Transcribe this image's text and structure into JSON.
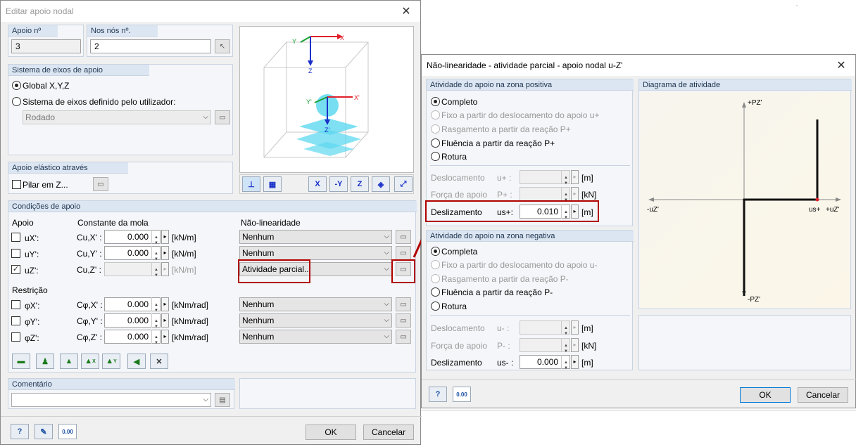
{
  "background": {
    "top_right_char": "·"
  },
  "dlg1": {
    "title": "Editar apoio nodal",
    "close_icon": "close-icon",
    "apoio_no": {
      "label": "Apoio nº",
      "value": "3"
    },
    "nos_no": {
      "label": "Nos nós nº.",
      "value": "2"
    },
    "sistema": {
      "header": "Sistema de eixos de apoio",
      "global": "Global X,Y,Z",
      "user": "Sistema de eixos definido pelo utilizador:",
      "combo": "Rodado"
    },
    "elastic": {
      "header": "Apoio elástico através",
      "pilar": "Pilar em Z..."
    },
    "preview_axes": {
      "x": "X",
      "y": "Y",
      "z": "Z",
      "xp": "X'",
      "yp": "Y'",
      "zp": "Z'"
    },
    "cond": {
      "header": "Condições de apoio",
      "col_apoio": "Apoio",
      "col_mola": "Constante da mola",
      "col_nl": "Não-linearidade",
      "restricao": "Restrição",
      "rows": [
        {
          "name": "uX':",
          "cname": "Cu,X' :",
          "value": "0.000",
          "unit": "[kN/m]",
          "nl": "Nenhum",
          "checked": ""
        },
        {
          "name": "uY':",
          "cname": "Cu,Y' :",
          "value": "0.000",
          "unit": "[kN/m]",
          "nl": "Nenhum",
          "checked": ""
        },
        {
          "name": "uZ':",
          "cname": "Cu,Z' :",
          "value": "",
          "unit": "[kN/m]",
          "nl": "Atividade parcial...",
          "checked": "✓"
        },
        {
          "name": "φX':",
          "cname": "Cφ,X' :",
          "value": "0.000",
          "unit": "[kNm/rad]",
          "nl": "Nenhum",
          "checked": ""
        },
        {
          "name": "φY':",
          "cname": "Cφ,Y' :",
          "value": "0.000",
          "unit": "[kNm/rad]",
          "nl": "Nenhum",
          "checked": ""
        },
        {
          "name": "φZ':",
          "cname": "Cφ,Z' :",
          "value": "0.000",
          "unit": "[kNm/rad]",
          "nl": "Nenhum",
          "checked": ""
        }
      ],
      "toolbar_marks": [
        "X",
        "Y"
      ]
    },
    "comment": {
      "header": "Comentário",
      "value": ""
    },
    "ok": "OK",
    "cancel": "Cancelar",
    "units_icon_text": "0.00"
  },
  "dlg2": {
    "title": "Não-linearidade - atividade parcial - apoio nodal u-Z'",
    "close_icon": "close-icon",
    "pos": {
      "header": "Atividade do apoio na zona positiva",
      "options": [
        "Completo",
        "Fixo a partir do deslocamento do apoio u+",
        "Rasgamento a partir da reação P+",
        "Fluência a partir da reação P+",
        "Rotura"
      ],
      "desl_label": "Deslocamento",
      "desl_sym": "u+ :",
      "desl_unit": "[m]",
      "forca_label": "Força de apoio",
      "forca_sym": "P+ :",
      "forca_unit": "[kN]",
      "desliz_label": "Deslizamento",
      "desliz_sym": "us+:",
      "desliz_value": "0.010",
      "desliz_unit": "[m]"
    },
    "neg": {
      "header": "Atividade do apoio na zona negativa",
      "options": [
        "Completa",
        "Fixo a partir do deslocamento do apoio u-",
        "Rasgamento a partir da reação P-",
        "Fluência a partir da reação P-",
        "Rotura"
      ],
      "desl_label": "Deslocamento",
      "desl_sym": "u- :",
      "desl_unit": "[m]",
      "forca_label": "Força de apoio",
      "forca_sym": "P- :",
      "forca_unit": "[kN]",
      "desliz_label": "Deslizamento",
      "desliz_sym": "us- :",
      "desliz_value": "0.000",
      "desliz_unit": "[m]"
    },
    "diagram": {
      "header": "Diagrama de atividade",
      "pz_pos": "+PZ'",
      "pz_neg": "-PZ'",
      "uz_neg": "-uZ'",
      "uz_pos": "+uZ'",
      "us_plus": "us+"
    },
    "ok": "OK",
    "cancel": "Cancelar",
    "units_icon_text": "0.00"
  },
  "colors": {
    "highlight_red": "#b00000",
    "group_header": "#dce6f2",
    "axis_red": "#e0202a",
    "axis_green": "#1aa030",
    "axis_blue": "#1a30c8",
    "support_cyan": "#5fd8f0"
  }
}
